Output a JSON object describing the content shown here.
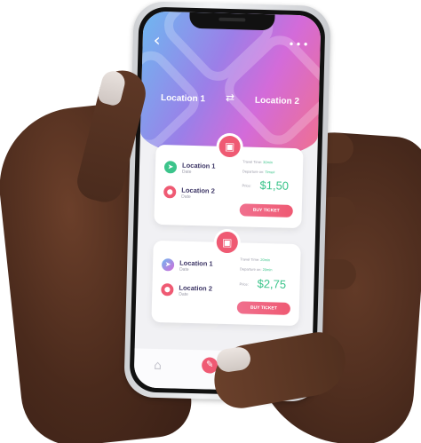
{
  "header": {
    "from_location": "Location 1",
    "to_location": "Location 2",
    "back_icon": "chevron-left-icon",
    "menu_icon": "more-dots-icon",
    "swap_icon": "swap-arrows-icon"
  },
  "tickets": [
    {
      "stop1_name": "Location 1",
      "stop1_sub": "Date",
      "stop2_name": "Location 2",
      "stop2_sub": "Date",
      "travel_label": "Travel Time:",
      "travel_value": "30min",
      "departure_label": "Departure on:",
      "departure_value": "Time#",
      "price_label": "Price:",
      "price": "$1,50",
      "buy_label": "BUY TICKET"
    },
    {
      "stop1_name": "Location 1",
      "stop1_sub": "Date",
      "stop2_name": "Location 2",
      "stop2_sub": "Date",
      "travel_label": "Travel Time:",
      "travel_value": "20min",
      "departure_label": "Departure on:",
      "departure_value": "20min",
      "price_label": "Price:",
      "price": "$2,75",
      "buy_label": "BUY TICKET"
    }
  ],
  "colors": {
    "accent": "#ef5a73",
    "price_green": "#3cc48b",
    "text_dark": "#3d3666"
  }
}
